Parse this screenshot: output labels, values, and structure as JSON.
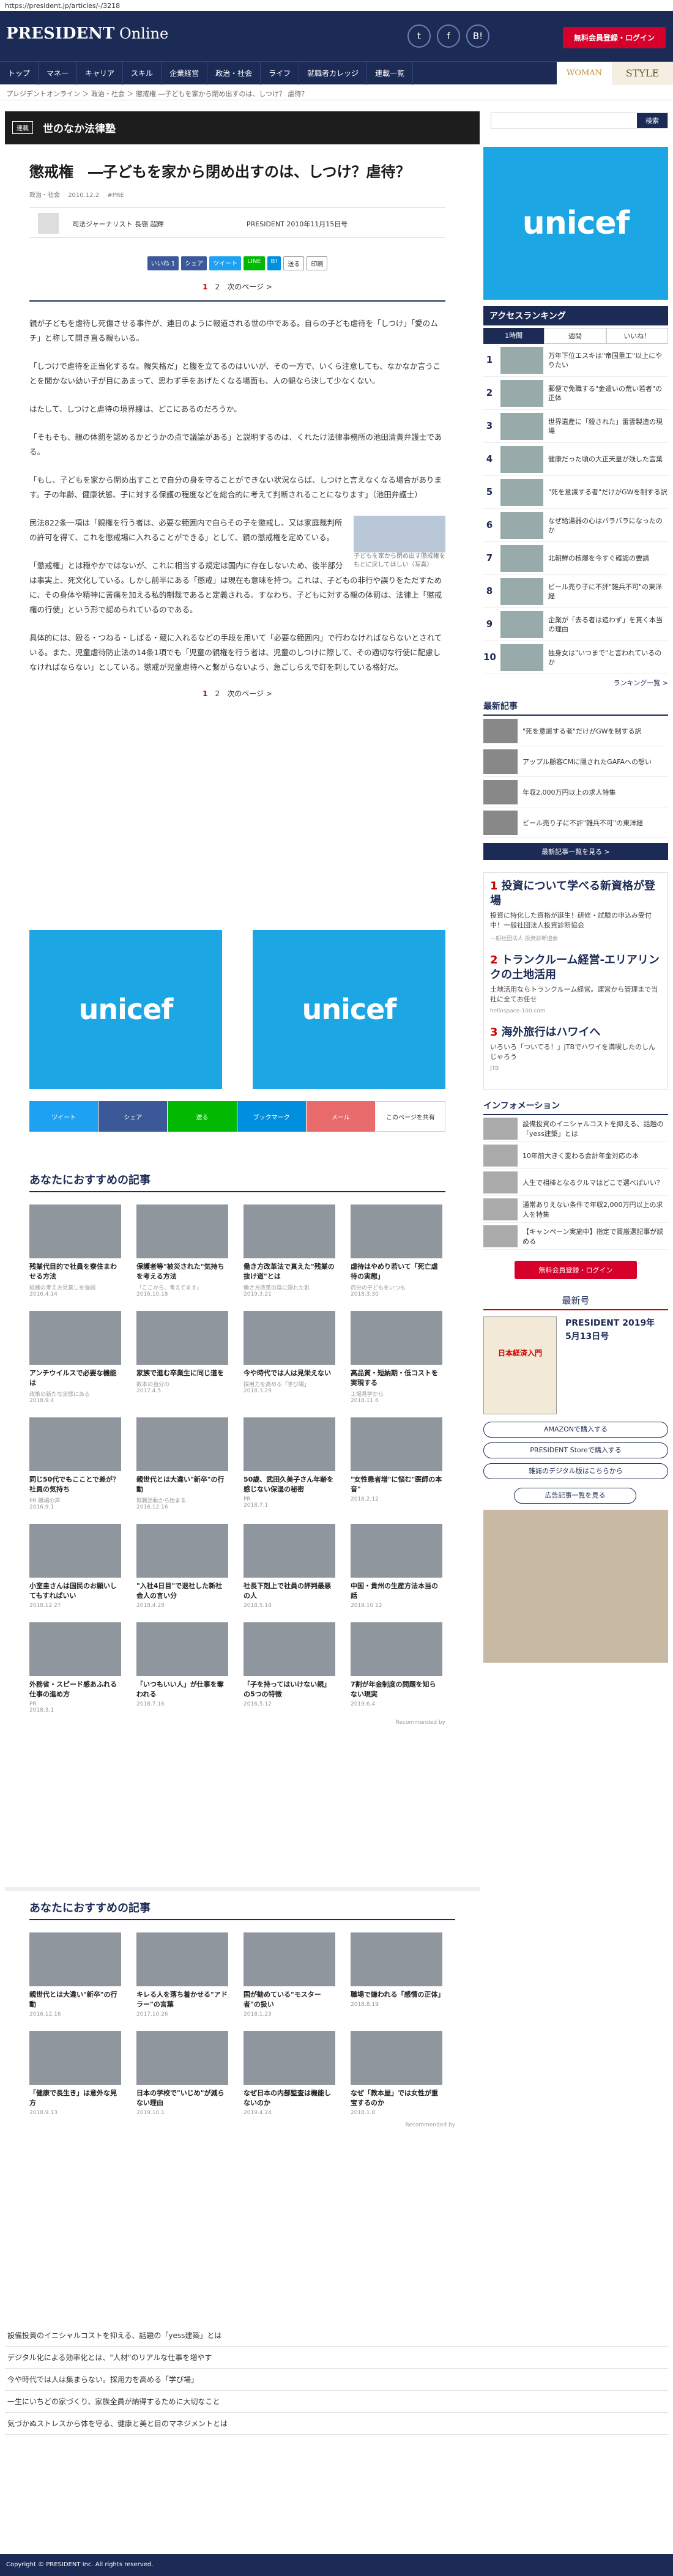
{
  "url": "https://president.jp/articles/-/3218",
  "header": {
    "logo_a": "PRESIDENT",
    "logo_b": " Online",
    "twitter": "t",
    "facebook": "f",
    "hatena": "B!",
    "register": "無料会員登録・ログイン"
  },
  "nav": [
    "トップ",
    "マネー",
    "キャリア",
    "スキル",
    "企業経営",
    "政治・社会",
    "ライフ",
    "就職者カレッジ",
    "連載一覧"
  ],
  "nav_woman": "WOMAN",
  "nav_style": "STYLE",
  "breadcrumb": "プレジデントオンライン ＞ 政治・社会 ＞ 懲戒権 ―子どもを家から閉め出すのは、しつけ？ 虐待？",
  "series": {
    "tag": "連載",
    "name": "世のなか法律塾"
  },
  "search": "検索",
  "article": {
    "title": "懲戒権　―子どもを家から閉め出すのは、しつけ？虐待？",
    "cat": "政治・社会",
    "date": "2010.12.2",
    "tag": "#PRE",
    "author": "司法ジャーナリスト 長嶺 超輝",
    "source": "PRESIDENT 2010年11月15日号",
    "share": [
      "いいね 1",
      "シェア",
      "ツイート",
      "LINE",
      "B!",
      "送る",
      "印刷"
    ],
    "pager_cur": "1",
    "pager_next": "2",
    "pager_label": "次のページ >",
    "paras": [
      "親が子どもを虐待し死傷させる事件が、連日のように報道される世の中である。自らの子ども虐待を「しつけ」「愛のムチ」と称して開き直る親もいる。",
      "「しつけで虐待を正当化するな。親失格だ」と腹を立てるのはいいが、その一方で、いくら注意しても、なかなか言うことを聞かない幼い子が目にあまって、思わず手をあげたくなる場面も、人の親なら決して少なくない。",
      "はたして、しつけと虐待の境界線は、どこにあるのだろうか。",
      "「そもそも、親の体罰を認めるかどうかの点で議論がある」と説明するのは、くれたけ法律事務所の池田清貴弁護士である。",
      "「もし、子どもを家から閉め出すことで自分の身を守ることができない状況ならば、しつけと言えなくなる場合があります。子の年齢、健康状態、子に対する保護の程度などを総合的に考えて判断されることになります」（池田弁護士）",
      "民法822条一項は「親権を行う者は、必要な範囲内で自らその子を懲戒し、又は家庭裁判所の許可を得て、これを懲戒場に入れることができる」として、親の懲戒権を定めている。",
      "「懲戒権」とは穏やかではないが、これに相当する規定は国内に存在しないため、後半部分は事実上、死文化している。しかし前半にある「懲戒」は現在も意味を持つ。これは、子どもの非行や誤りをただすために、その身体や精神に苦痛を加える私的制裁であると定義される。すなわち、子どもに対する親の体罰は、法律上「懲戒権の行使」という形で認められているのである。",
      "具体的には、殴る・つねる・しばる・蔵に入れるなどの手段を用いて「必要な範囲内」で行わなければならないとされている。また、児童虐待防止法の14条1項でも「児童の親権を行う者は、児童のしつけに際して、その適切な行使に配慮しなければならない」としている。懲戒が児童虐待へと繋がらないよう、急ごしらえで釘を刺している格好だ。"
    ],
    "img_caption": "子どもを家から閉め出す懲戒権をもとに戻してほしい（写真）"
  },
  "unicef": "unicef",
  "sharebar": [
    "ツイート",
    "シェア",
    "送る",
    "ブックマーク",
    "メール",
    "このページを共有"
  ],
  "rec1": {
    "title": "あなたにおすすめの記事",
    "items": [
      {
        "t": "残業代目的で社員を寮住まわせる方法",
        "s": "組織の考え方見直しを強調",
        "d": "2016.4.14"
      },
      {
        "t": "保護者等\"被災された\"気持ちを考える方法",
        "s": "「ここから、考えてます」",
        "d": "2016.10.18"
      },
      {
        "t": "働き方改革法で真えた\"残業の抜け道\"とは",
        "s": "働き方改革の陰に隠れた影",
        "d": "2019.3.21"
      },
      {
        "t": "虐待はやめり若いて「死亡虐待の実態」",
        "s": "自分の子どもをいつも",
        "d": "2018.3.30"
      },
      {
        "t": "アンチウイルスで必要な機能は",
        "s": "政策の新たな実態にある",
        "d": "2018.9.4"
      },
      {
        "t": "家族で進む卒業生に同じ道を",
        "s": "数本の自分の",
        "d": "2017.4.5"
      },
      {
        "t": "今や時代では人は見栄えない",
        "s": "採用力を高める「学び場」",
        "d": "2018.3.29"
      },
      {
        "t": "高品質・短納期・低コストを実現する",
        "s": "工場見学から",
        "d": "2018.11.6"
      },
      {
        "t": "同じ50代でもこことで差が？社員の気持ち",
        "s": "PR 職場の声",
        "d": "2016.9.1"
      },
      {
        "t": "親世代とは大違い\"新卒\"の行動",
        "s": "就職活動から始まる",
        "d": "2016.12.16"
      },
      {
        "t": "50歳、武田久美子さん年齢を感じない保湿の秘密",
        "s": "PR ",
        "d": "2018.7.1"
      },
      {
        "t": "\"女性患者増\"に悩む\"医師の本音\"",
        "s": "",
        "d": "2016.2.12"
      },
      {
        "t": "小室圭さんは国民のお願いしてもすればいい",
        "s": "",
        "d": "2018.12.27"
      },
      {
        "t": "\"入社4日目\"で退社した新社会人の言い分",
        "s": "",
        "d": "2018.4.28"
      },
      {
        "t": "社長下剋上で社員の評判最悪の人",
        "s": "",
        "d": "2018.5.18"
      },
      {
        "t": "中国・貴州の生産方法本当の話",
        "s": "",
        "d": "2019.10.12"
      },
      {
        "t": "外務省・スピード感あふれる仕事の進め方",
        "s": "PR",
        "d": "2018.3.1"
      },
      {
        "t": "「いつもいい人」が仕事を奪われる",
        "s": "",
        "d": "2018.7.16"
      },
      {
        "t": "「子を持ってはいけない親」の5つの特徴",
        "s": "",
        "d": "2016.5.12"
      },
      {
        "t": "7割が年金制度の問題を知らない現実",
        "s": "",
        "d": "2019.6.4"
      }
    ]
  },
  "rec2": {
    "title": "あなたにおすすめの記事",
    "items": [
      {
        "t": "親世代とは大違い\"新卒\"の行動",
        "s": "",
        "d": "2016.12.16"
      },
      {
        "t": "キレる人を落ち着かせる\"アドラー\"の言葉",
        "s": "",
        "d": "2017.10.26"
      },
      {
        "t": "国が勧めている\"モスター者\"の扱い",
        "s": "",
        "d": "2018.1.23"
      },
      {
        "t": "職場で嫌われる「感情の正体」",
        "s": "",
        "d": "2018.8.19"
      },
      {
        "t": "「健康で長生き」は意外な見方",
        "s": "",
        "d": "2018.9.13"
      },
      {
        "t": "日本の学校で\"いじめ\"が減らない理由",
        "s": "",
        "d": "2019.10.1"
      },
      {
        "t": "なぜ日本の内部監査は機能しないのか",
        "s": "",
        "d": "2019.4.24"
      },
      {
        "t": "なぜ「教本屋」では女性が重宝するのか",
        "s": "",
        "d": "2018.1.8"
      }
    ]
  },
  "recommended_by": "Recommended by",
  "ranking": {
    "title": "アクセスランキング",
    "tabs": [
      "1時間",
      "週間",
      "いいね！"
    ],
    "items": [
      "万年下位エスキは\"帝国重工\"以上にやりたい",
      "郵便で免職する\"金遣いの荒い若者\"の正体",
      "世界遺産に「殺された」雷雲製造の現場",
      "健康だった頃の大正天皇が残した言葉",
      "\"死を意識する者\"だけがGWを制する訳",
      "なぜ給湯器の心はバラバラになったのか",
      "北朝鮮の核爆を今すぐ確認の要請",
      "ビール売り子に不評\"雑兵不可\"の東洋経",
      "企業が「去る者は追わず」を貫く本当の理由",
      "独身女は\"いつまで\"と言われているのか"
    ],
    "more": "ランキング一覧 >"
  },
  "latest": {
    "title": "最新記事",
    "items": [
      "\"死を意識する者\"だけがGWを制する訳",
      "アップル顧客CMに隠されたGAFAへの想い",
      "年収2,000万円以上の求人特集",
      "ビール売り子に不評\"雑兵不可\"の東洋経"
    ],
    "more": "最新記事一覧を見る >"
  },
  "ads": [
    {
      "n": "1",
      "h": "投資について学べる新資格が登場",
      "t": "投資に特化した資格が誕生！研修・試験の申込み受付中！一般社団法人投資診断協会",
      "s": "一般社団法人 投資診断協会"
    },
    {
      "n": "2",
      "h": "トランクルーム経営-エリアリンクの土地活用",
      "t": "土地活用ならトランクルーム経営。運営から管理まで当社に全てお任せ",
      "s": "hellospace-100.com"
    },
    {
      "n": "3",
      "h": "海外旅行はハワイへ",
      "t": "いろいろ「ついてる！」JTBでハワイを満喫したのしんじゃろう",
      "s": "JTB"
    }
  ],
  "info": {
    "title": "インフォメーション",
    "items": [
      "設備投資のイニシャルコストを抑える、話題の「yess建築」とは",
      "10年前大きく変わる会計年金対応の本",
      "人生で相棒となるクルマはどこで選べばいい？",
      "通常ありえない条件で年収2,000万円以上の求人を特集",
      "【キャンペーン実施中】指定で買厳選記事が読める"
    ]
  },
  "magazine": {
    "title": "最新号",
    "issue": "PRESIDENT 2019年5月13日号",
    "sub": "日本経済入門",
    "btns": [
      "AMAZONで購入する",
      "PRESIDENT Storeで購入する",
      "雑誌のデジタル版はこちらから"
    ],
    "adbtn": "広告記事一覧を見る"
  },
  "bottom_links": [
    "設備投資のイニシャルコストを抑える、話題の「yess建築」とは",
    "デジタル化による効率化とは、\"人材\"のリアルな仕事を増やす",
    "今や時代では人は集まらない。採用力を高める「学び場」",
    "一生にいちどの家づくり、家族全員が納得するために大切なこと",
    "気づかぬストレスから体を守る、健康と美と目のマネジメントとは"
  ],
  "footer": "Copyright © PRESIDENT Inc. All rights reserved."
}
